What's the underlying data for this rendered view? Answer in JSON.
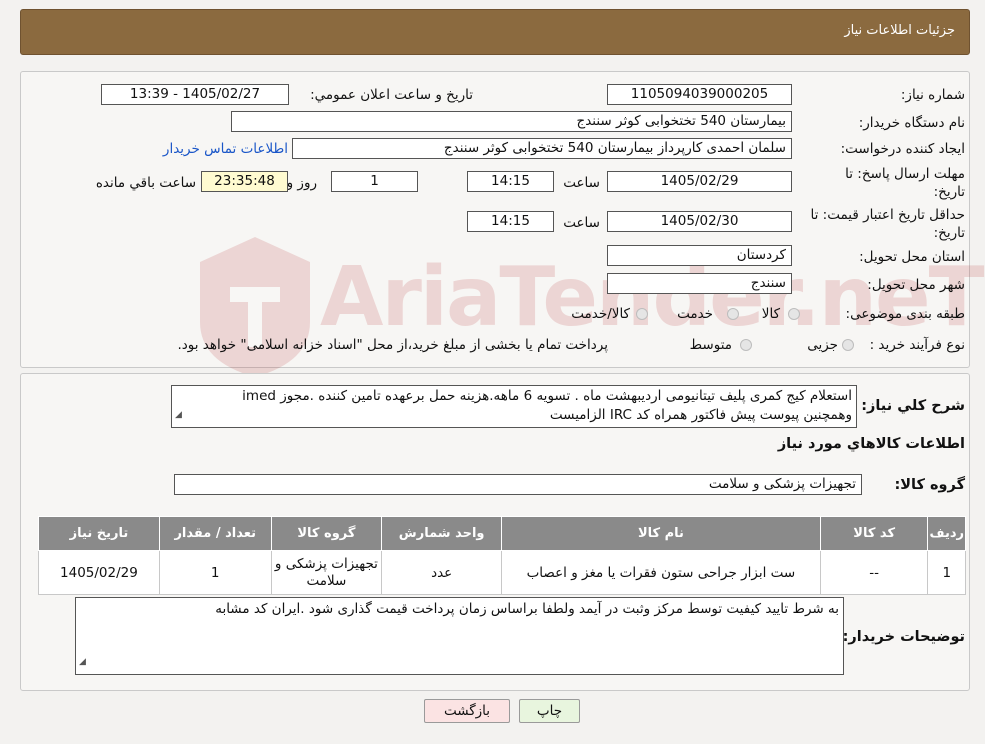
{
  "header": {
    "title": "جزئیات اطلاعات نیاز"
  },
  "form": {
    "need_number_label": "شماره نیاز:",
    "need_number": "1105094039000205",
    "announce_label": "تاریخ و ساعت اعلان عمومي:",
    "announce_value": "1405/02/27 - 13:39",
    "buyer_org_label": "نام دستگاه خريدار:",
    "buyer_org": "بیمارستان 540 تختخوابی کوثر سنندج",
    "creator_label": "ایجاد کننده درخواست:",
    "creator": "سلمان احمدی کارپرداز بیمارستان 540 تختخوابی کوثر سنندج",
    "contact_link": "اطلاعات تماس خریدار",
    "reply_deadline_label_1": "مهلت ارسال پاسخ: تا",
    "reply_deadline_label_2": "تاریخ:",
    "reply_date": "1405/02/29",
    "time_label": "ساعت",
    "reply_time": "14:15",
    "days_value": "1",
    "days_label": "روز و",
    "remaining_time": "23:35:48",
    "remaining_label": "ساعت باقي مانده",
    "price_validity_label_1": "حداقل تاریخ اعتبار قیمت: تا",
    "price_validity_label_2": "تاریخ:",
    "price_validity_date": "1405/02/30",
    "price_validity_time": "14:15",
    "province_label": "استان محل تحویل:",
    "province": "کردستان",
    "city_label": "شهر محل تحویل:",
    "city": "سنندج",
    "category_label": "طبقه بندی موضوعی:",
    "category_options": [
      "کالا",
      "خدمت",
      "کالا/خدمت"
    ],
    "process_label": "نوع فرآیند خرید :",
    "process_options": [
      "جزیی",
      "متوسط"
    ],
    "process_note": "پرداخت تمام یا بخشی از مبلغ خرید،از محل \"اسناد خزانه اسلامی\" خواهد بود."
  },
  "description": {
    "label": "شرح کلي نياز:",
    "line1": "استعلام کیج کمری پلیف تیتانیومی اردیبهشت ماه . تسویه 6 ماهه.هزینه حمل برعهده تامین کننده .مجوز imed",
    "line2": "وهمچنین پیوست پیش فاکتور همراه کد IRC  الزامیست"
  },
  "goods": {
    "section_title": "اطلاعات کالاهاي مورد نياز",
    "group_label": "گروه کالا:",
    "group_value": "تجهیزات پزشکی و سلامت",
    "columns": [
      "رديف",
      "کد کالا",
      "نام کالا",
      "واحد شمارش",
      "گروه کالا",
      "تعداد / مقدار",
      "تاریخ نیاز"
    ],
    "rows": [
      {
        "index": "1",
        "code": "--",
        "name": "ست ابزار جراحی ستون فقرات یا مغز و اعصاب",
        "unit": "عدد",
        "group": "تجهیزات پزشکی و سلامت",
        "qty": "1",
        "date": "1405/02/29"
      }
    ]
  },
  "buyer_notes": {
    "label": "توضیحات خریدار:",
    "text": "به شرط تایید کیفیت توسط مرکز وثبت در آیمد ولطفا براساس زمان پرداخت قیمت گذاری شود .ایران کد مشابه"
  },
  "buttons": {
    "print": "چاپ",
    "back": "بازگشت"
  },
  "watermark": {
    "text": "AriaTender.neT"
  },
  "colors": {
    "header": "#8b6a3f",
    "table_header": "#8a8a8a",
    "link": "#1a56c8",
    "print_btn": "#e8f5de",
    "back_btn": "#fbe3e3"
  },
  "icons": {
    "watermark_logo": "ariatender-logo"
  }
}
